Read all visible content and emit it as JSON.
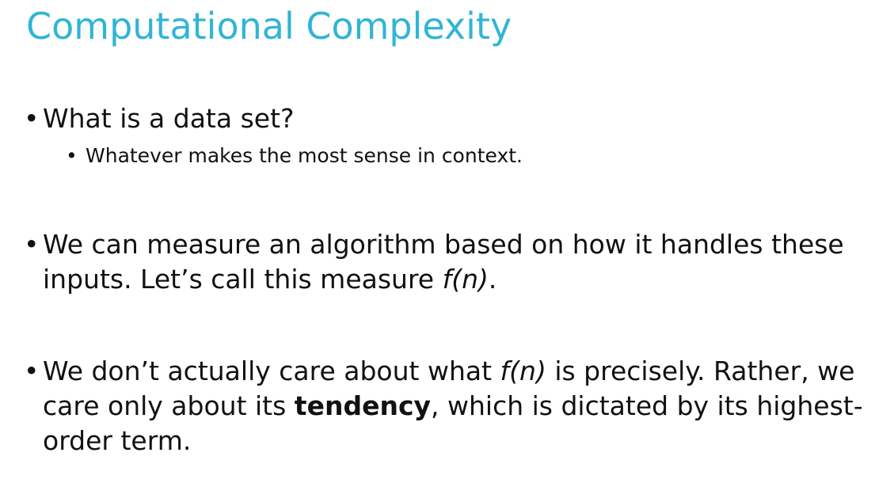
{
  "slide": {
    "title": "Computational Complexity",
    "bullets": [
      {
        "text": "What is a data set?",
        "sub": "Whatever makes the most sense in context."
      },
      {
        "line1": "We can measure an algorithm based on how it handles these",
        "line2_pre": "inputs. Let’s call this measure ",
        "line2_em": "f(n)",
        "line2_post": "."
      },
      {
        "line1_pre": "We don’t actually care about what ",
        "line1_em": "f(n)",
        "line1_post": " is precisely. Rather, we",
        "line2_pre": "care only about its ",
        "line2_strong": "tendency",
        "line2_post": ", which is dictated by its highest-",
        "line3": "order term."
      }
    ],
    "bullet_symbol": "•"
  },
  "colors": {
    "title": "#31b5d4",
    "text": "#111111",
    "background": "#ffffff"
  }
}
